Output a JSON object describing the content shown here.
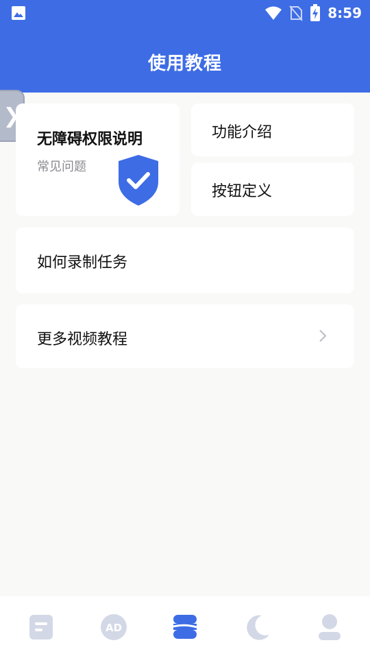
{
  "status": {
    "time": "8:59",
    "icons": [
      "image-icon",
      "wifi-icon",
      "no-sim-icon",
      "battery-charging-icon"
    ]
  },
  "header": {
    "title": "使用教程"
  },
  "side_handle": {
    "glyph": "❯"
  },
  "cards": {
    "accessibility": {
      "title": "无障碍权限说明",
      "subtitle": "常见问题",
      "icon": "shield-check-icon"
    },
    "feature_intro": {
      "label": "功能介绍"
    },
    "button_definition": {
      "label": "按钮定义"
    },
    "record_task": {
      "label": "如何录制任务"
    },
    "more_videos": {
      "label": "更多视频教程",
      "icon": "chevron-right-icon"
    }
  },
  "bottom_nav": {
    "items": [
      {
        "icon": "document-icon",
        "active": false
      },
      {
        "icon": "ad-icon",
        "active": false
      },
      {
        "icon": "layers-icon",
        "active": true
      },
      {
        "icon": "moon-icon",
        "active": false
      },
      {
        "icon": "user-icon",
        "active": false
      }
    ],
    "colors": {
      "active": "#3d6ce5",
      "inactive": "#d3d8e6"
    }
  },
  "colors": {
    "primary": "#3d6ce5",
    "background": "#f9f9f8"
  }
}
